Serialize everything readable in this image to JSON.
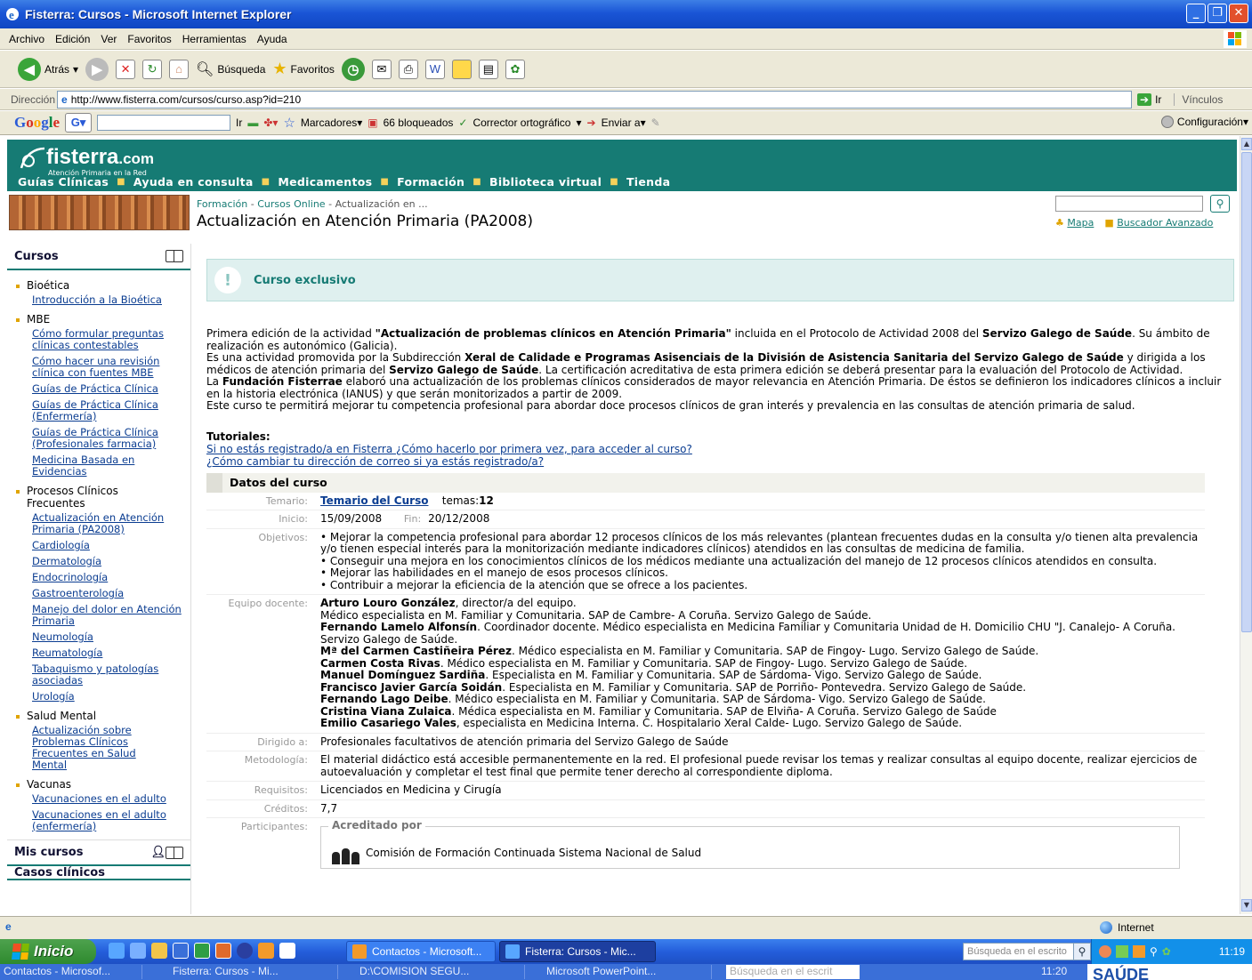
{
  "window": {
    "title": "Fisterra: Cursos - Microsoft Internet Explorer"
  },
  "menu": [
    "Archivo",
    "Edición",
    "Ver",
    "Favoritos",
    "Herramientas",
    "Ayuda"
  ],
  "toolbar": {
    "back": "Atrás",
    "search": "Búsqueda",
    "favorites": "Favoritos"
  },
  "address": {
    "label": "Dirección",
    "url": "http://www.fisterra.com/cursos/curso.asp?id=210",
    "go": "Ir",
    "links": "Vínculos"
  },
  "googlebar": {
    "logo": "Google",
    "go": "Ir",
    "bookmarks": "Marcadores▾",
    "blocked": "66 bloqueados",
    "spell": "Corrector ortográfico",
    "send": "Enviar a▾",
    "config": "Configuración▾"
  },
  "site": {
    "logo": "fisterra",
    "logo_suffix": ".com",
    "tagline": "Atención Primaria en la Red",
    "nav": [
      "Guías Clínicas",
      "Ayuda en consulta",
      "Medicamentos",
      "Formación",
      "Biblioteca virtual",
      "Tienda"
    ],
    "breadcrumb": [
      "Formación",
      "Cursos Online",
      "Actualización en ..."
    ],
    "page_title": "Actualización en Atención Primaria (PA2008)",
    "top_links": [
      "Mapa",
      "Buscador Avanzado"
    ]
  },
  "sidebar": {
    "title": "Cursos",
    "sections": [
      {
        "name": "Bioética",
        "links": [
          "Introducción a la Bioética"
        ]
      },
      {
        "name": "MBE",
        "links": [
          "Cómo formular preguntas clínicas contestables",
          "Cómo hacer una revisión clínica con fuentes MBE",
          "Guías de Práctica Clínica",
          "Guías de Práctica Clínica (Enfermería)",
          "Guías de Práctica Clínica (Profesionales farmacia)",
          "Medicina Basada en Evidencias"
        ]
      },
      {
        "name": "Procesos Clínicos Frecuentes",
        "links": [
          "Actualización en Atención Primaria (PA2008)",
          "Cardiología",
          "Dermatología",
          "Endocrinología",
          "Gastroenterología",
          "Manejo del dolor en Atención Primaria",
          "Neumología",
          "Reumatología",
          "Tabaquismo y patologías asociadas",
          "Urología"
        ]
      },
      {
        "name": "Salud Mental",
        "links": [
          "Actualización sobre Problemas Clínicos Frecuentes en Salud Mental"
        ]
      },
      {
        "name": "Vacunas",
        "links": [
          "Vacunaciones en el adulto",
          "Vacunaciones en el adulto (enfermería)"
        ]
      }
    ],
    "my_courses": "Mis cursos",
    "next_partial": "Casos clínicos"
  },
  "main": {
    "exclusive_title": "Curso exclusivo",
    "intro": {
      "p1_a": "Primera edición de la actividad ",
      "p1_b": "\"Actualización de problemas clínicos en Atención Primaria\"",
      "p1_c": " incluida en el Protocolo de Actividad 2008 del ",
      "p1_d": "Servizo Galego de Saúde",
      "p1_e": ". Su ámbito de realización es autonómico (Galicia).",
      "p2_a": "Es una actividad promovida por la Subdirección ",
      "p2_b": "Xeral de Calidade e Programas Asisenciais de la División de Asistencia Sanitaria del Servizo Galego de Saúde",
      "p2_c": " y dirigida a los médicos de atención primaria del ",
      "p2_d": "Servizo Galego de Saúde",
      "p2_e": ". La certificación acreditativa de esta primera edición se deberá presentar para la evaluación del Protocolo de Actividad.",
      "p3_a": "La ",
      "p3_b": "Fundación Fisterrae",
      "p3_c": " elaboró una actualización de los problemas clínicos considerados de mayor relevancia en Atención Primaria. De éstos se definieron los indicadores clínicos a incluir en la historia electrónica (IANUS) y que serán monitorizados a partir de 2009.",
      "p4": "Este curso te permitirá mejorar tu competencia profesional para abordar doce procesos clínicos de gran interés y prevalencia en las consultas de atención primaria de salud."
    },
    "tutorials_title": "Tutoriales:",
    "tutorials": [
      "Si no estás registrado/a en Fisterra ¿Cómo hacerlo por primera vez, para acceder al curso?",
      "¿Cómo cambiar tu dirección de correo si ya estás registrado/a?"
    ],
    "data_title": "Datos del curso",
    "rows": {
      "temario_k": "Temario:",
      "temario_link": "Temario del Curso",
      "temas_label": "temas:",
      "temas_count": "12",
      "inicio_k": "Inicio:",
      "inicio_v": "15/09/2008",
      "fin_k": "Fin:",
      "fin_v": "20/12/2008",
      "objetivos_k": "Objetivos:",
      "objetivos": [
        "• Mejorar la competencia profesional para abordar 12 procesos clínicos de los más relevantes (plantean frecuentes dudas en la consulta y/o tienen alta prevalencia y/o tienen especial interés para la monitorización mediante indicadores clínicos) atendidos en las consultas de medicina de familia.",
        "• Conseguir una mejora en los conocimientos clínicos de los médicos mediante una actualización del manejo de 12 procesos clínicos atendidos en consulta.",
        "• Mejorar las habilidades en el manejo de esos procesos clínicos.",
        "• Contribuir a mejorar la eficiencia de la atención que se ofrece a los pacientes."
      ],
      "equipo_k": "Equipo docente:",
      "equipo": [
        {
          "n": "Arturo Louro González",
          "d": ", director/a del equipo."
        },
        {
          "n": "",
          "d": "Médico especialista en M. Familiar y Comunitaria. SAP de Cambre- A Coruña. Servizo Galego de Saúde."
        },
        {
          "n": "Fernando Lamelo Alfonsín",
          "d": ". Coordinador docente. Médico especialista en Medicina Familiar y Comunitaria Unidad de H. Domicilio CHU \"J. Canalejo- A Coruña. Servizo Galego de Saúde."
        },
        {
          "n": "Mª del Carmen Castiñeira Pérez",
          "d": ". Médico especialista en M. Familiar y Comunitaria. SAP de Fingoy- Lugo. Servizo Galego de Saúde."
        },
        {
          "n": "Carmen Costa Rivas",
          "d": ". Médico especialista en M. Familiar y Comunitaria. SAP de Fingoy- Lugo. Servizo Galego de Saúde."
        },
        {
          "n": "Manuel Domínguez Sardiña",
          "d": ". Especialista en M. Familiar y Comunitaria. SAP de Sárdoma- Vigo. Servizo Galego de Saúde."
        },
        {
          "n": "Francisco Javier García Soidán",
          "d": ". Especialista en M. Familiar y Comunitaria. SAP de Porriño- Pontevedra. Servizo Galego de Saúde."
        },
        {
          "n": "Fernando Lago Deibe",
          "d": ". Médico especialista en M. Familiar y Comunitaria. SAP de Sárdoma- Vigo. Servizo Galego de Saúde."
        },
        {
          "n": "Cristina Viana Zulaica",
          "d": ". Médica especialista en M. Familiar y Comunitaria. SAP de Elviña- A Coruña. Servizo Galego de Saúde"
        },
        {
          "n": "Emilio Casariego Vales",
          "d": ", especialista en Medicina Interna. C. Hospitalario Xeral Calde- Lugo. Servizo Galego de Saúde."
        }
      ],
      "dirigido_k": "Dirigido a:",
      "dirigido_v": "Profesionales facultativos de atención primaria del Servizo Galego de Saúde",
      "metodologia_k": "Metodología:",
      "metodologia_v": "El material didáctico está accesible permanentemente en la red. El profesional puede revisar los temas y realizar consultas al equipo docente, realizar ejercicios de autoevaluación y completar el test final que permite tener derecho al correspondiente diploma.",
      "requisitos_k": "Requisitos:",
      "requisitos_v": "Licenciados en Medicina y Cirugía",
      "creditos_k": "Créditos:",
      "creditos_v": "7,7",
      "participantes_k": "Participantes:",
      "acreditado_por": "Acreditado por",
      "acreditador": "Comisión de Formación Continuada Sistema Nacional de Salud"
    }
  },
  "status": {
    "zone": "Internet"
  },
  "taskbar": {
    "start": "Inicio",
    "tasks": [
      "Contactos - Microsoft...",
      "Fisterra: Cursos - Mic..."
    ],
    "search_placeholder": "Búsqueda en el escrito",
    "clock": "11:19"
  },
  "ghost_taskbar": {
    "items": [
      "Contactos - Microsof...",
      "Fisterra: Cursos - Mi...",
      "D:\\COMISION SEGU...",
      "Microsoft PowerPoint..."
    ],
    "search": "Búsqueda en el escrit",
    "clock": "11:20",
    "brand": "SAÚDE"
  },
  "colors": {
    "brand": "#167b74",
    "link": "#0b3d91",
    "accent": "#e0a400"
  }
}
